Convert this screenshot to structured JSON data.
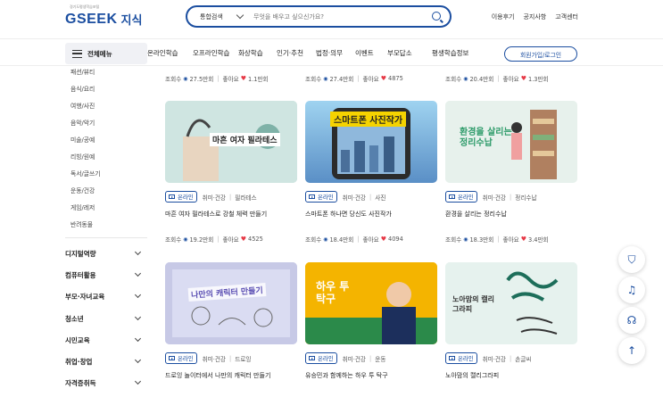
{
  "header": {
    "logo_small": "경기도평생학습포털",
    "logo_main": "GSEEK",
    "logo_sub": "지식",
    "search_category": "통합검색",
    "search_placeholder": "무엇을 배우고 싶으신가요?",
    "links": [
      "이용후기",
      "공지사항",
      "고객센터"
    ]
  },
  "nav": {
    "all_menu": "전체메뉴",
    "items": [
      "온라인학습",
      "오프라인학습",
      "화상학습",
      "인기·추천",
      "법정·의무",
      "이벤트",
      "부모답소",
      "평생학습정보"
    ],
    "signup": "회원가입/로그인"
  },
  "sidebar": {
    "sub_items": [
      "패션/뷰티",
      "음식/요리",
      "여행/사진",
      "음악/악기",
      "미술/공예",
      "리빙/원예",
      "독서/글쓰기",
      "운동/건강",
      "게임/레저",
      "반려동물"
    ],
    "categories": [
      "디지털역량",
      "컴퓨터활용",
      "부모·자녀교육",
      "청소년",
      "시민교육",
      "취업·창업",
      "자격증취득"
    ]
  },
  "row0_stats": [
    {
      "views": "27.5만회",
      "likes": "1.1만회"
    },
    {
      "views": "27.4만회",
      "likes": "4875"
    },
    {
      "views": "20.4만회",
      "likes": "1.3만회"
    }
  ],
  "cards": [
    {
      "thumb_text": "마흔 여자 필라테스",
      "badge": "온라인",
      "tags": [
        "취미·건강",
        "필라테스"
      ],
      "title": "마흔 여자 필라테스로 강철 체력 만들기",
      "views": "19.2만회",
      "likes": "4525"
    },
    {
      "thumb_text": "스마트폰 사진작가",
      "badge": "온라인",
      "tags": [
        "취미·건강",
        "사진"
      ],
      "title": "스마트폰 하나면 당신도 사진작가",
      "views": "18.4만회",
      "likes": "4094"
    },
    {
      "thumb_text": "환경을 살리는 정리수납",
      "badge": "온라인",
      "tags": [
        "취미·건강",
        "정리수납"
      ],
      "title": "환경을 살리는 정리수납",
      "views": "18.3만회",
      "likes": "3.4만회"
    },
    {
      "thumb_text": "나만의 캐릭터 만들기",
      "badge": "온라인",
      "tags": [
        "취미·건강",
        "드로잉"
      ],
      "title": "드로잉 놀이터에서 나만의 캐릭터 만들기",
      "views": "",
      "likes": ""
    },
    {
      "thumb_text": "하우 투 탁구",
      "badge": "온라인",
      "tags": [
        "취미·건강",
        "운동"
      ],
      "title": "유승민과 함께하는 하우 투 탁구",
      "views": "",
      "likes": ""
    },
    {
      "thumb_text": "노아맘의 캘리그라피",
      "badge": "온라인",
      "tags": [
        "취미·건강",
        "손글씨"
      ],
      "title": "노아맘의 캘리그라피",
      "views": "",
      "likes": ""
    }
  ],
  "labels": {
    "views_prefix": "조회수",
    "likes_prefix": "좋아요"
  }
}
